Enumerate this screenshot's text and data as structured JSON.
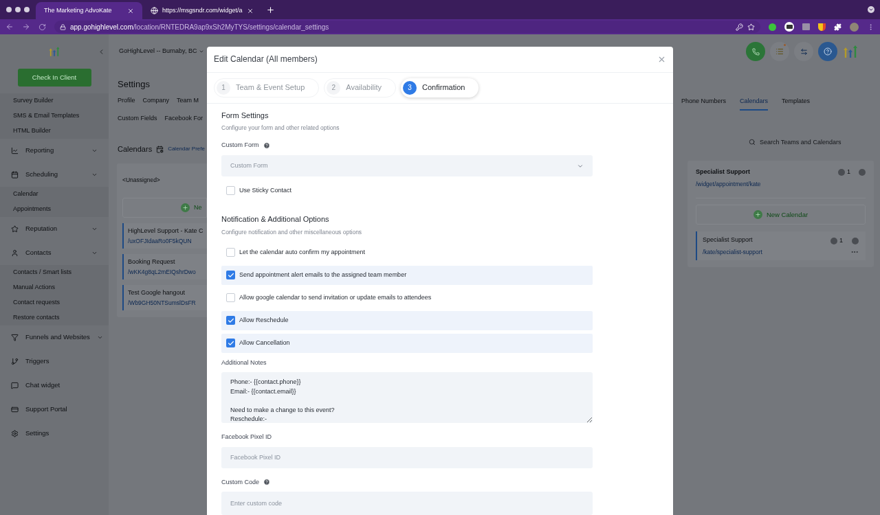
{
  "browser": {
    "tabs": [
      {
        "title": "The Marketing AdvoKate",
        "selected": true
      },
      {
        "title": "https://msgsndr.com/widget/a",
        "selected": false
      }
    ],
    "url": {
      "domain": "app.gohighlevel.com",
      "path": "/location/RNTEDRA9ap9xSh2MyTYS/settings/calendar_settings"
    }
  },
  "sidebar": {
    "check_in": "Check In Client",
    "items": [
      {
        "kind": "link",
        "label": "Survey Builder"
      },
      {
        "kind": "link",
        "label": "SMS & Email Templates"
      },
      {
        "kind": "link",
        "label": "HTML Builder"
      },
      {
        "kind": "section",
        "label": "Reporting",
        "expandable": true
      },
      {
        "kind": "section",
        "label": "Scheduling",
        "expandable": true
      },
      {
        "kind": "link",
        "label": "Calendar"
      },
      {
        "kind": "link",
        "label": "Appointments"
      },
      {
        "kind": "section",
        "label": "Reputation",
        "expandable": true
      },
      {
        "kind": "section",
        "label": "Contacts",
        "expandable": true
      },
      {
        "kind": "link",
        "label": "Contacts / Smart lists"
      },
      {
        "kind": "link",
        "label": "Manual Actions"
      },
      {
        "kind": "link",
        "label": "Contact requests"
      },
      {
        "kind": "link",
        "label": "Restore contacts"
      },
      {
        "kind": "section",
        "label": "Funnels and Websites",
        "expandable": true
      },
      {
        "kind": "section",
        "label": "Triggers",
        "expandable": false
      },
      {
        "kind": "section",
        "label": "Chat widget",
        "expandable": false
      },
      {
        "kind": "section",
        "label": "Support Portal",
        "expandable": false
      },
      {
        "kind": "section",
        "label": "Settings",
        "expandable": false
      }
    ]
  },
  "header": {
    "location": "GoHighLevel -- Burnaby, BC"
  },
  "settings": {
    "title": "Settings",
    "tabs_left": [
      {
        "label": "Profile",
        "selected": false
      },
      {
        "label": "Company",
        "selected": false
      },
      {
        "label": "Team M",
        "selected": false
      }
    ],
    "tabs_row2": [
      {
        "label": "Custom Fields",
        "selected": false
      },
      {
        "label": "Facebook For",
        "selected": false
      }
    ],
    "tabs_right": [
      {
        "label": "Phone Numbers",
        "selected": false
      },
      {
        "label": "Calendars",
        "selected": true
      },
      {
        "label": "Templates",
        "selected": false
      }
    ]
  },
  "calendars": {
    "title": "Calendars",
    "preferences_link": "Calendar Prefe",
    "search": {
      "placeholder": "Search Teams and Calendars"
    },
    "left_group": {
      "name": "<Unassigned>",
      "new_button": "Ne",
      "items": [
        {
          "name": "HighLevel Support - Kate C",
          "slug": "/uxOFJIdaaRo0F5kQUN"
        },
        {
          "name": "Booking Request",
          "slug": "/wKK4g8qL2mEIQshrDwo"
        },
        {
          "name": "Test Google hangout",
          "slug": "/Wb9GH50NTSumslDsFR"
        }
      ]
    },
    "right_group": {
      "name": "Specialist Support",
      "slug": "/widget/appointment/kate",
      "count": "1",
      "new_button": "New Calendar",
      "items": [
        {
          "name": "Specialist Support",
          "slug": "/kate/specialist-support",
          "count": "1"
        }
      ]
    }
  },
  "modal": {
    "title": "Edit Calendar (All members)",
    "steps": [
      {
        "number": "1",
        "label": "Team & Event Setup",
        "selected": false
      },
      {
        "number": "2",
        "label": "Availability",
        "selected": false
      },
      {
        "number": "3",
        "label": "Confirmation",
        "selected": true
      }
    ],
    "form_settings": {
      "title": "Form Settings",
      "description": "Configure your form and other related options",
      "custom_form_label": "Custom Form",
      "custom_form_placeholder": "Custom Form",
      "sticky": {
        "label": "Use Sticky Contact",
        "checked": false
      }
    },
    "notifications": {
      "title": "Notification & Additional Options",
      "description": "Configure notification and other miscellaneous options",
      "options": [
        {
          "label": "Let the calendar auto confirm my appointment",
          "checked": false
        },
        {
          "label": "Send appointment alert emails to the assigned team member",
          "checked": true
        },
        {
          "label": "Allow google calendar to send invitation or update emails to attendees",
          "checked": false
        },
        {
          "label": "Allow Reschedule",
          "checked": true
        },
        {
          "label": "Allow Cancellation",
          "checked": true
        }
      ]
    },
    "notes": {
      "label": "Additional Notes",
      "value": "Phone:- {{contact.phone}}\nEmail:- {{contact.email}}\n\nNeed to make a change to this event?\nReschedule:-"
    },
    "pixel": {
      "label": "Facebook Pixel ID",
      "placeholder": "Facebook Pixel ID"
    },
    "custom_code": {
      "label": "Custom Code",
      "placeholder": "Enter custom code"
    }
  }
}
